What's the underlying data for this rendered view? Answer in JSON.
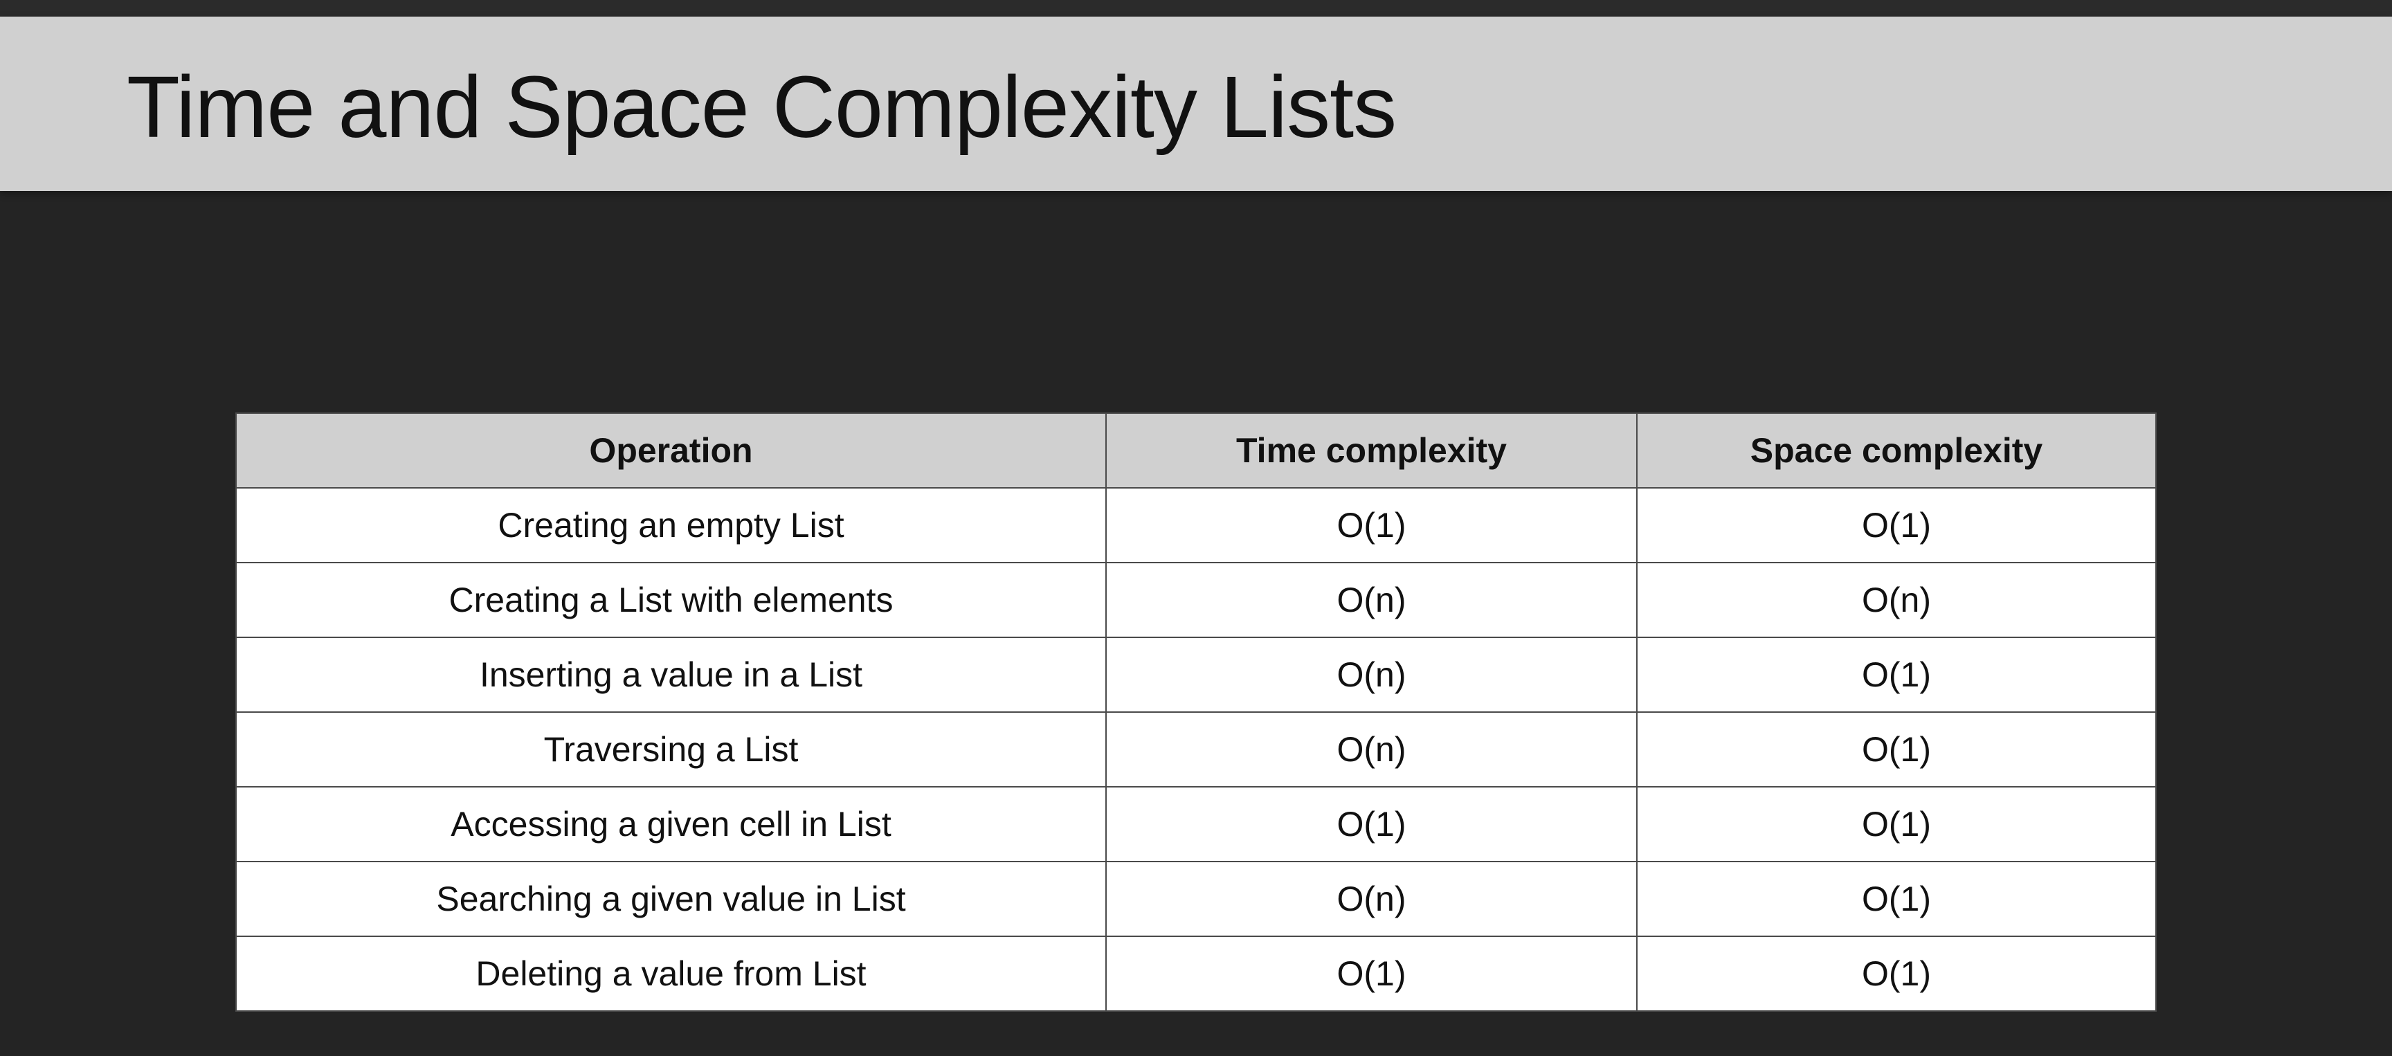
{
  "slide": {
    "title": "Time and Space Complexity Lists"
  },
  "table": {
    "headers": [
      "Operation",
      "Time complexity",
      "Space complexity"
    ],
    "rows": [
      [
        "Creating an empty List",
        "O(1)",
        "O(1)"
      ],
      [
        "Creating a List with elements",
        "O(n)",
        "O(n)"
      ],
      [
        "Inserting a value in a List",
        "O(n)",
        "O(1)"
      ],
      [
        "Traversing a List",
        "O(n)",
        "O(1)"
      ],
      [
        "Accessing a given cell in List",
        "O(1)",
        "O(1)"
      ],
      [
        "Searching a given value in List",
        "O(n)",
        "O(1)"
      ],
      [
        "Deleting a value from List",
        "O(1)",
        "O(1)"
      ]
    ]
  },
  "colors": {
    "background": "#242424",
    "title_bar": "#d0d0d0",
    "header_fill": "#d0d0d0",
    "cell_fill": "#ffffff",
    "border": "#4a4a4a",
    "text": "#111111"
  }
}
